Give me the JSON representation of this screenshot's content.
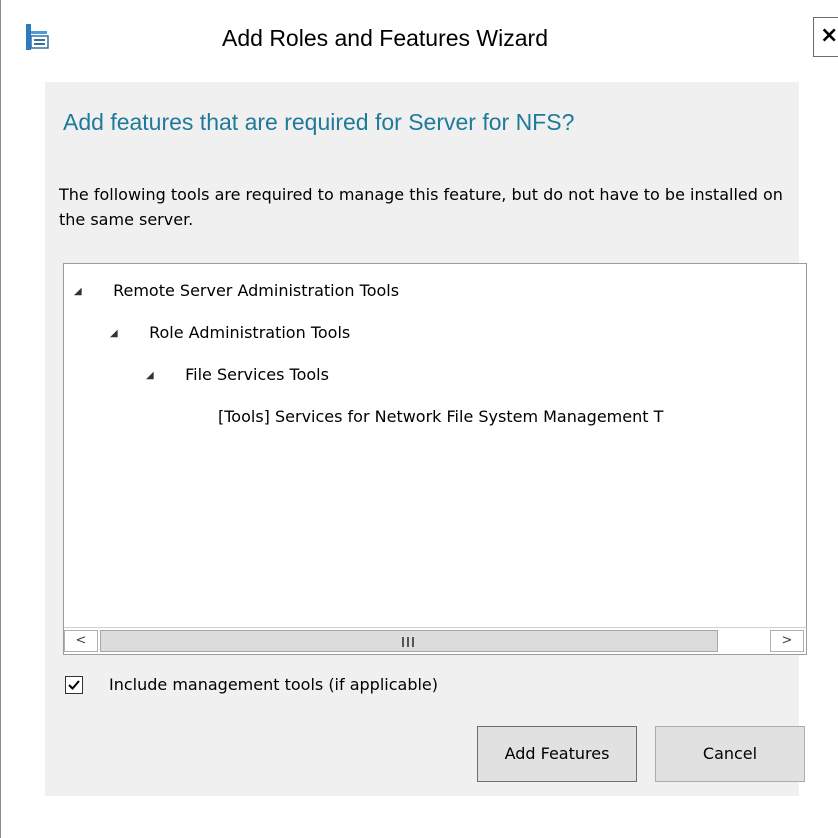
{
  "window": {
    "title": "Add Roles and Features Wizard",
    "close_label": "×"
  },
  "dialog": {
    "heading": "Add features that are required for Server for NFS?",
    "description": "The following tools are required to manage this feature, but do not have to be installed on the same server."
  },
  "tree": {
    "items": [
      {
        "label": "Remote Server Administration Tools",
        "expanded": true
      },
      {
        "label": "Role Administration Tools",
        "expanded": true
      },
      {
        "label": "File Services Tools",
        "expanded": true
      },
      {
        "label": "[Tools] Services for Network File System Management T"
      }
    ],
    "expander_glyph": "◢",
    "scroll_left_glyph": "<",
    "scroll_right_glyph": ">"
  },
  "options": {
    "include_tools_label": "Include management tools (if applicable)",
    "include_tools_checked": true
  },
  "buttons": {
    "add_features": "Add Features",
    "cancel": "Cancel"
  },
  "colors": {
    "heading": "#1f7a9a",
    "content_bg": "#f0f0f0",
    "button_bg": "#e1e1e1"
  }
}
